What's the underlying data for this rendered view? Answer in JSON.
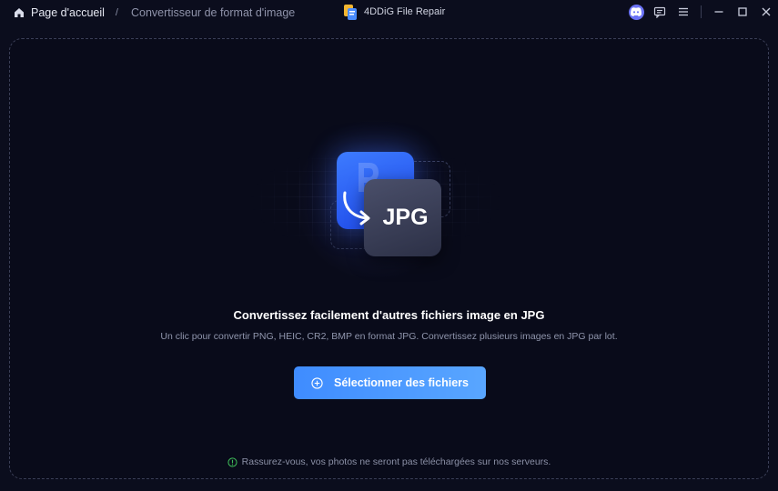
{
  "header": {
    "home_label": "Page d'accueil",
    "separator": "/",
    "current_page": "Convertisseur de format d'image",
    "app_name": "4DDiG File Repair"
  },
  "hero": {
    "format_label": "JPG"
  },
  "main": {
    "headline": "Convertissez facilement d'autres fichiers image en JPG",
    "description": "Un clic pour convertir PNG, HEIC, CR2, BMP en format JPG. Convertissez plusieurs images en JPG par lot.",
    "select_button_label": "Sélectionner des fichiers",
    "privacy_note": "Rassurez-vous, vos photos ne seront pas téléchargées sur nos serveurs."
  },
  "colors": {
    "accent": "#4a96ff",
    "background": "#0b0d1d",
    "discord": "#6b73f6",
    "safe_icon": "#3fbf5a"
  },
  "icons": [
    "home-icon",
    "app-logo-icon",
    "discord-icon",
    "feedback-icon",
    "menu-icon",
    "minimize-icon",
    "maximize-icon",
    "close-icon",
    "plus-circle-icon",
    "shield-check-icon"
  ]
}
